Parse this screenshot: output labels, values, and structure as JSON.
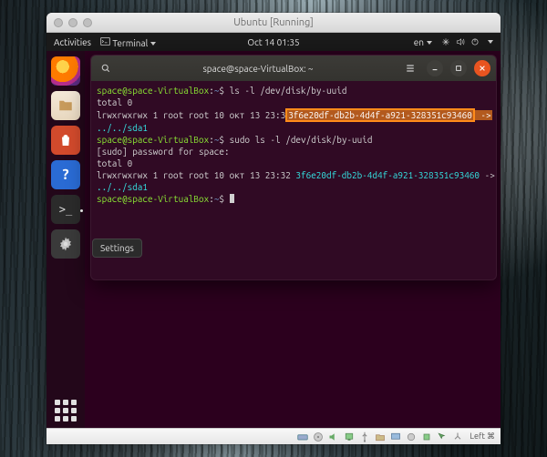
{
  "host_window": {
    "title": "Ubuntu [Running]"
  },
  "gnome_topbar": {
    "activities": "Activities",
    "app_menu": "Terminal",
    "clock": "Oct 14  01:35",
    "lang": "en"
  },
  "dock": {
    "tooltip": "Settings"
  },
  "terminal_window": {
    "title": "space@space-VirtualBox: ~"
  },
  "terminal": {
    "prompt_user_host": "space@space-VirtualBox",
    "prompt_path": "~",
    "cmd1": "ls -l /dev/disk/by-uuid",
    "out_total": "total 0",
    "out_perm_line_prefix": "lrwxrwxrwx 1 root root 10 окт 13 23:32 ",
    "out_perm_line_prefix_short": "lrwxrwxrwx 1 root root 10 окт 13 23:3",
    "uuid": "3f6e20df-db2b-4d4f-a921-328351c93460",
    "arrow": " ->",
    "link_target": "../../sda1",
    "cmd2": "sudo ls -l /dev/disk/by-uuid",
    "sudo_prompt": "[sudo] password for space:"
  },
  "vbox_statusbar": {
    "host_key": "Left ⌘"
  }
}
